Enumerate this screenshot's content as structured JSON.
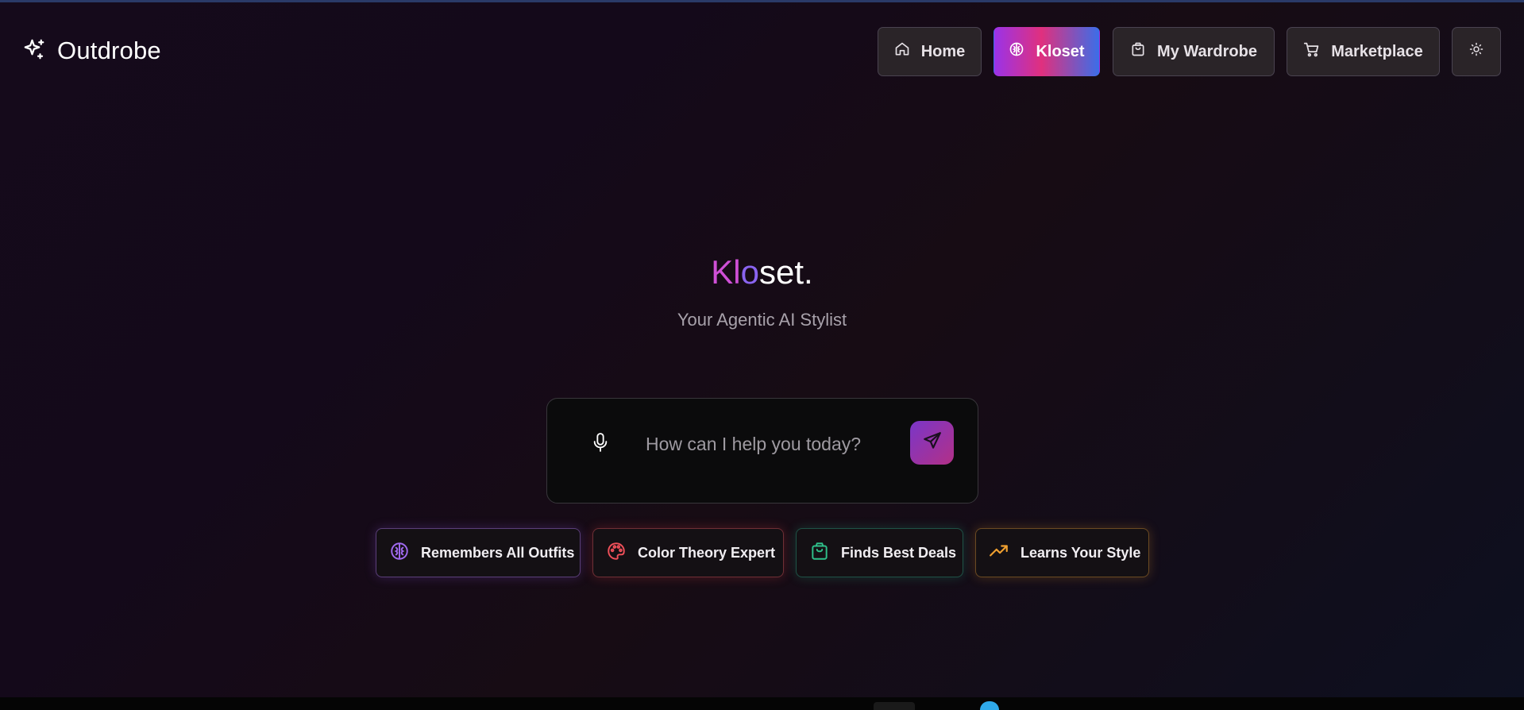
{
  "app": {
    "name": "Outdrobe"
  },
  "nav": {
    "items": [
      {
        "label": "Home",
        "icon": "home-icon",
        "active": false
      },
      {
        "label": "Kloset",
        "icon": "brain-icon",
        "active": true
      },
      {
        "label": "My Wardrobe",
        "icon": "shopping-bag-icon",
        "active": false
      },
      {
        "label": "Marketplace",
        "icon": "cart-icon",
        "active": false
      }
    ],
    "theme_toggle_icon": "sun-icon"
  },
  "hero": {
    "title_part1": "Kl",
    "title_part2": "o",
    "title_part3": "set.",
    "subtitle": "Your Agentic AI Stylist"
  },
  "chat": {
    "placeholder": "How can I help you today?",
    "mic_icon": "microphone-icon",
    "send_icon": "send-icon"
  },
  "features": [
    {
      "label": "Remembers All Outfits",
      "icon": "brain-icon",
      "color": "#a06af0"
    },
    {
      "label": "Color Theory Expert",
      "icon": "palette-icon",
      "color": "#f0505a"
    },
    {
      "label": "Finds Best Deals",
      "icon": "shopping-bag-icon",
      "color": "#2fbf8a"
    },
    {
      "label": "Learns Your Style",
      "icon": "trending-up-icon",
      "color": "#f0a030"
    }
  ],
  "colors": {
    "accent_purple": "#9a33e8",
    "accent_pink": "#e0307e",
    "accent_blue": "#3b6ee8",
    "background": "#150a1b"
  }
}
